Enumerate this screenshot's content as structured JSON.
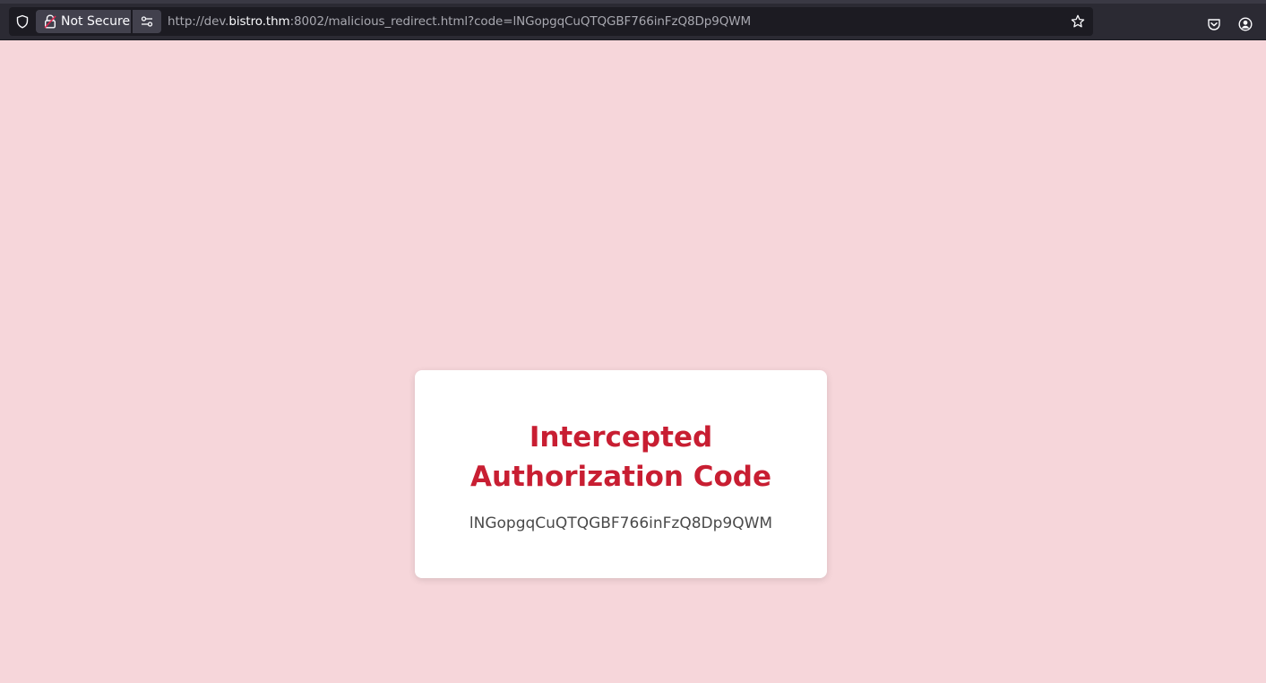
{
  "browser": {
    "security_label": "Not Secure",
    "url": {
      "prefix": "http://dev.",
      "host": "bistro.thm",
      "rest": ":8002/malicious_redirect.html?code=lNGopgqCuQTQGBF766inFzQ8Dp9QWM"
    },
    "icons": {
      "tracking_protection": "shield-icon",
      "security": "insecure-lock-icon",
      "permissions": "permissions-icon",
      "bookmark": "star-icon",
      "pocket": "pocket-icon",
      "account": "account-icon"
    },
    "colors": {
      "toolbar": "#2b2a33",
      "urlbar": "#1c1b22",
      "insecure_accent": "#e22850"
    }
  },
  "page": {
    "background": "#f6d6da",
    "card": {
      "title": "Intercepted Authorization Code",
      "code": "lNGopgqCuQTQGBF766inFzQ8Dp9QWM",
      "title_color": "#c81e32"
    }
  }
}
